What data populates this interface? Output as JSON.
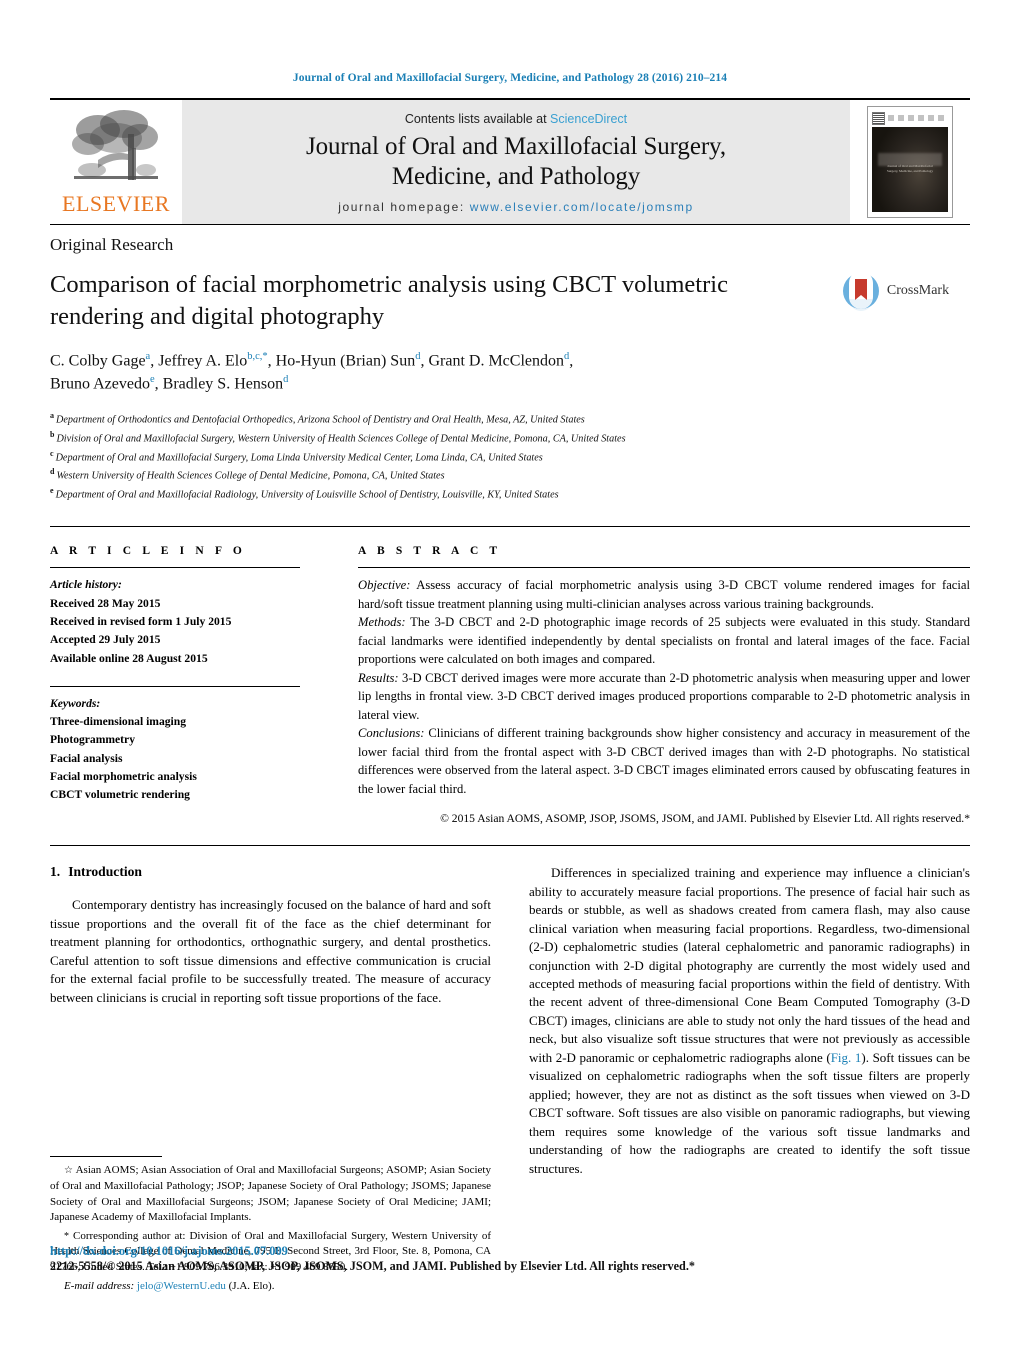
{
  "running_head": "Journal of Oral and Maxillofacial Surgery, Medicine, and Pathology 28 (2016) 210–214",
  "masthead": {
    "publisher_name": "ELSEVIER",
    "contents_prefix": "Contents lists available at ",
    "contents_link": "ScienceDirect",
    "journal_title_line1": "Journal of Oral and Maxillofacial Surgery,",
    "journal_title_line2": "Medicine, and Pathology",
    "homepage_prefix": "journal homepage: ",
    "homepage_url": "www.elsevier.com/locate/jomsmp",
    "cover_caption_line1": "Journal of Oral and Maxillofacial",
    "cover_caption_line2": "Surgery, Medicine, and Pathology"
  },
  "article": {
    "type": "Original Research",
    "title": "Comparison of facial morphometric analysis using CBCT volumetric rendering and digital photography",
    "crossmark_label": "CrossMark",
    "authors_line1_a": "C. Colby Gage",
    "authors_sup_a": "a",
    "authors_line1_b": ", Jeffrey A. Elo",
    "authors_sup_b": "b,c,*",
    "authors_line1_c": ", Ho-Hyun (Brian) Sun",
    "authors_sup_c": "d",
    "authors_line1_d": ", Grant D. McClendon",
    "authors_sup_d": "d",
    "authors_line1_e": ",",
    "authors_line2_a": "Bruno Azevedo",
    "authors_sup_e": "e",
    "authors_line2_b": ", Bradley S. Henson",
    "authors_sup_f": "d",
    "affiliations": [
      {
        "mark": "a",
        "text": "Department of Orthodontics and Dentofacial Orthopedics, Arizona School of Dentistry and Oral Health, Mesa, AZ, United States"
      },
      {
        "mark": "b",
        "text": "Division of Oral and Maxillofacial Surgery, Western University of Health Sciences College of Dental Medicine, Pomona, CA, United States"
      },
      {
        "mark": "c",
        "text": "Department of Oral and Maxillofacial Surgery, Loma Linda University Medical Center, Loma Linda, CA, United States"
      },
      {
        "mark": "d",
        "text": "Western University of Health Sciences College of Dental Medicine, Pomona, CA, United States"
      },
      {
        "mark": "e",
        "text": "Department of Oral and Maxillofacial Radiology, University of Louisville School of Dentistry, Louisville, KY, United States"
      }
    ]
  },
  "info": {
    "heading": "A R T I C L E   I N F O",
    "history_label": "Article history:",
    "history": [
      "Received 28 May 2015",
      "Received in revised form 1 July 2015",
      "Accepted 29 July 2015",
      "Available online 28 August 2015"
    ],
    "keywords_label": "Keywords:",
    "keywords": [
      "Three-dimensional imaging",
      "Photogrammetry",
      "Facial analysis",
      "Facial morphometric analysis",
      "CBCT volumetric rendering"
    ]
  },
  "abstract": {
    "heading": "A B S T R A C T",
    "objective_label": "Objective:",
    "objective_text": " Assess accuracy of facial morphometric analysis using 3-D CBCT volume rendered images for facial hard/soft tissue treatment planning using multi-clinician analyses across various training backgrounds.",
    "methods_label": "Methods:",
    "methods_text": " The 3-D CBCT and 2-D photographic image records of 25 subjects were evaluated in this study. Standard facial landmarks were identified independently by dental specialists on frontal and lateral images of the face. Facial proportions were calculated on both images and compared.",
    "results_label": "Results:",
    "results_text": " 3-D CBCT derived images were more accurate than 2-D photometric analysis when measuring upper and lower lip lengths in frontal view. 3-D CBCT derived images produced proportions comparable to 2-D photometric analysis in lateral view.",
    "conclusions_label": "Conclusions:",
    "conclusions_text": " Clinicians of different training backgrounds show higher consistency and accuracy in measurement of the lower facial third from the frontal aspect with 3-D CBCT derived images than with 2-D photographs. No statistical differences were observed from the lateral aspect. 3-D CBCT images eliminated errors caused by obfuscating features in the lower facial third.",
    "copyright": "© 2015 Asian AOMS, ASOMP, JSOP, JSOMS, JSOM, and JAMI. Published by Elsevier Ltd. All rights reserved.*"
  },
  "introduction": {
    "number": "1.",
    "heading": "Introduction",
    "paragraph_1": "Contemporary dentistry has increasingly focused on the balance of hard and soft tissue proportions and the overall fit of the face as the chief determinant for treatment planning for orthodontics, orthognathic surgery, and dental prosthetics. Careful attention to soft tissue dimensions and effective communication is crucial for the external facial profile to be successfully treated. The measure of accuracy between clinicians is crucial in reporting soft tissue proportions of the face.",
    "paragraph_2_part1": "Differences in specialized training and experience may influence a clinician's ability to accurately measure facial proportions. The presence of facial hair such as beards or stubble, as well as shadows created from camera flash, may also cause clinical variation when measuring facial proportions. Regardless, two-dimensional (2-D) cephalometric studies (lateral cephalometric and panoramic radiographs) in conjunction with 2-D digital photography are currently the most widely used and accepted methods of measuring facial proportions within the field of dentistry. With the recent advent of three-dimensional Cone Beam Computed Tomography (3-D CBCT) images, clinicians are able to study not only the hard tissues of the head and neck, but also visualize soft tissue structures that were not previously as accessible with 2-D panoramic or cephalometric radiographs alone (",
    "paragraph_2_link": "Fig. 1",
    "paragraph_2_part2": "). Soft tissues can be visualized on cephalometric radiographs when the soft tissue filters are properly applied; however, they are not as distinct as the soft tissues when viewed on 3-D CBCT software. Soft tissues are also visible on panoramic radiographs, but viewing them requires some knowledge of the various soft tissue landmarks and understanding of how the radiographs are created to identify the soft tissue structures."
  },
  "footnotes": {
    "abbrev_symbol": "☆",
    "abbrev_text": " Asian AOMS; Asian Association of Oral and Maxillofacial Surgeons; ASOMP; Asian Society of Oral and Maxillofacial Pathology; JSOP; Japanese Society of Oral Pathology; JSOMS; Japanese Society of Oral and Maxillofacial Surgeons; JSOM; Japanese Society of Oral Medicine; JAMI; Japanese Academy of Maxillofacial Implants.",
    "corresponding_symbol": "*",
    "corresponding_text": " Corresponding author at: Division of Oral and Maxillofacial Surgery, Western University of Health Sciences College of Dental Medicine, 795 E. Second Street, 3rd Floor, Ste. 8, Pomona, CA 91766, United States. Tel.: +1 909 706 3910; fax: +1 909 469 8650.",
    "email_label": "E-mail address:",
    "email_address": "jelo@WesternU.edu",
    "email_suffix": " (J.A. Elo)."
  },
  "page_footer": {
    "doi": "http://dx.doi.org/10.1016/j.ajoms.2015.07.009",
    "issn_line": "2212-5558/© 2015 Asian AOMS, ASOMP, JSOP, JSOMS, JSOM, and JAMI. Published by Elsevier Ltd. All rights reserved.*"
  },
  "colors": {
    "link_blue": "#1a7fb5",
    "elsevier_orange": "#E87722",
    "band_gray": "#e8e8e8",
    "crossmark_blue": "#6ab0de",
    "crossmark_red": "#c63a2d"
  }
}
